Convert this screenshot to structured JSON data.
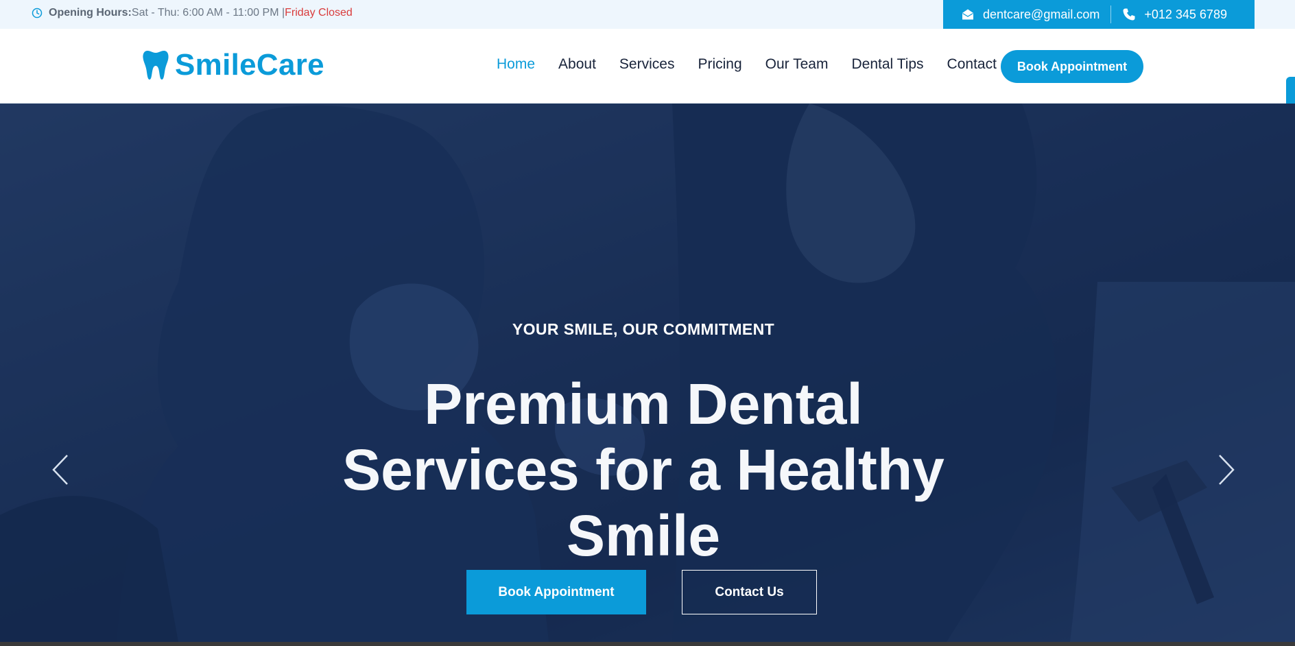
{
  "topbar": {
    "hours_label": "Opening Hours:",
    "hours_value": "Sat - Thu: 6:00 AM - 11:00 PM |",
    "closed_text": "Friday Closed",
    "email": "dentcare@gmail.com",
    "phone": "+012 345 6789",
    "icons": [
      "clock-icon",
      "envelope-icon",
      "phone-icon"
    ]
  },
  "nav": {
    "brand": "SmileCare",
    "brand_icon": "tooth-icon",
    "items": [
      {
        "label": "Home",
        "active": true
      },
      {
        "label": "About",
        "active": false
      },
      {
        "label": "Services",
        "active": false
      },
      {
        "label": "Pricing",
        "active": false
      },
      {
        "label": "Our Team",
        "active": false
      },
      {
        "label": "Dental Tips",
        "active": false
      },
      {
        "label": "Contact",
        "active": false
      }
    ],
    "cta": "Book Appointment"
  },
  "hero": {
    "eyebrow": "YOUR SMILE, OUR COMMITMENT",
    "headline_line1": "Premium Dental",
    "headline_line2": "Services for a Healthy",
    "headline_line3": "Smile",
    "primary_button": "Book Appointment",
    "secondary_button": "Contact Us",
    "prev_icon": "chevron-left-icon",
    "next_icon": "chevron-right-icon"
  },
  "colors": {
    "accent": "#0b9bd9",
    "closed": "#d93b3b",
    "nav_text": "#18233a",
    "hero_overlay": "#12264e"
  }
}
